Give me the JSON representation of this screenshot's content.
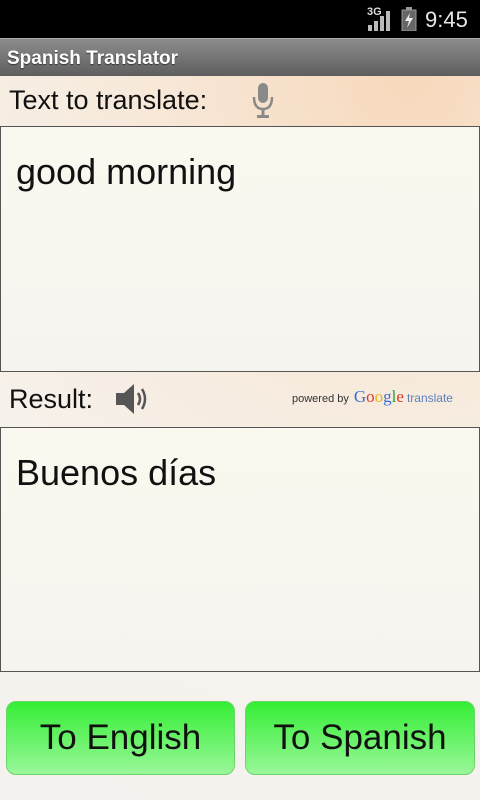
{
  "status_bar": {
    "network": "3G",
    "time": "9:45",
    "signal_icon": "signal-bars-icon",
    "battery_icon": "battery-charging-icon"
  },
  "app": {
    "title": "Spanish Translator"
  },
  "input": {
    "label": "Text to translate:",
    "mic_icon": "microphone-icon",
    "value": "good morning"
  },
  "result": {
    "label": "Result:",
    "speaker_icon": "speaker-icon",
    "value": "Buenos días",
    "powered_by": {
      "prefix": "powered by",
      "google": [
        "G",
        "o",
        "o",
        "g",
        "l",
        "e"
      ],
      "google_colors": [
        "#3b6fd6",
        "#d8382c",
        "#eab11b",
        "#3b6fd6",
        "#2e9e3e",
        "#d8382c"
      ],
      "suffix": "translate"
    }
  },
  "buttons": {
    "to_english": "To English",
    "to_spanish": "To Spanish"
  },
  "colors": {
    "button_green": "#35ee35",
    "title_bar": "#7a7a7a",
    "status_bar": "#000000"
  }
}
